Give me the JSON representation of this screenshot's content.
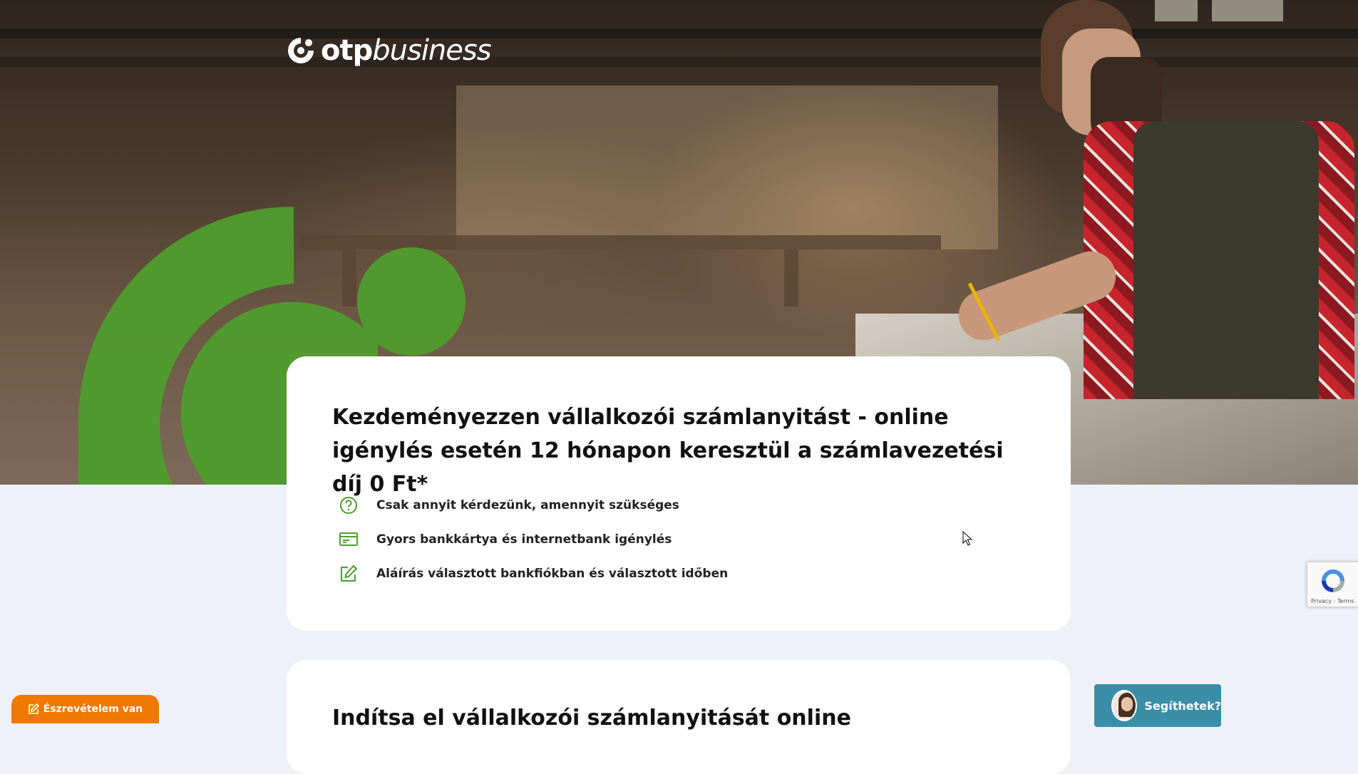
{
  "brand": {
    "logo_bold": "otp",
    "logo_light": "business",
    "accent_green": "#4f9d2d",
    "brand_orange": "#f07800"
  },
  "hero": {
    "title": "Kezdeményezzen vállalkozói számlanyitást - online igénylés esetén 12 hónapon keresztül a számlavezetési díj 0 Ft*",
    "features": [
      {
        "icon": "question-circle-icon",
        "label": "Csak annyit kérdezünk, amennyit szükséges"
      },
      {
        "icon": "card-icon",
        "label": "Gyors bankkártya és internetbank igénylés"
      },
      {
        "icon": "edit-icon",
        "label": "Aláírás választott bankfiókban és választott időben"
      }
    ]
  },
  "second_section": {
    "title_partial": "Indítsa el vállalkozói számlanyitását online"
  },
  "recaptcha": {
    "links": "Privacy - Terms"
  },
  "help_button": {
    "label": "Segíthetek?"
  },
  "feedback_button": {
    "label": "Észrevételem van"
  }
}
